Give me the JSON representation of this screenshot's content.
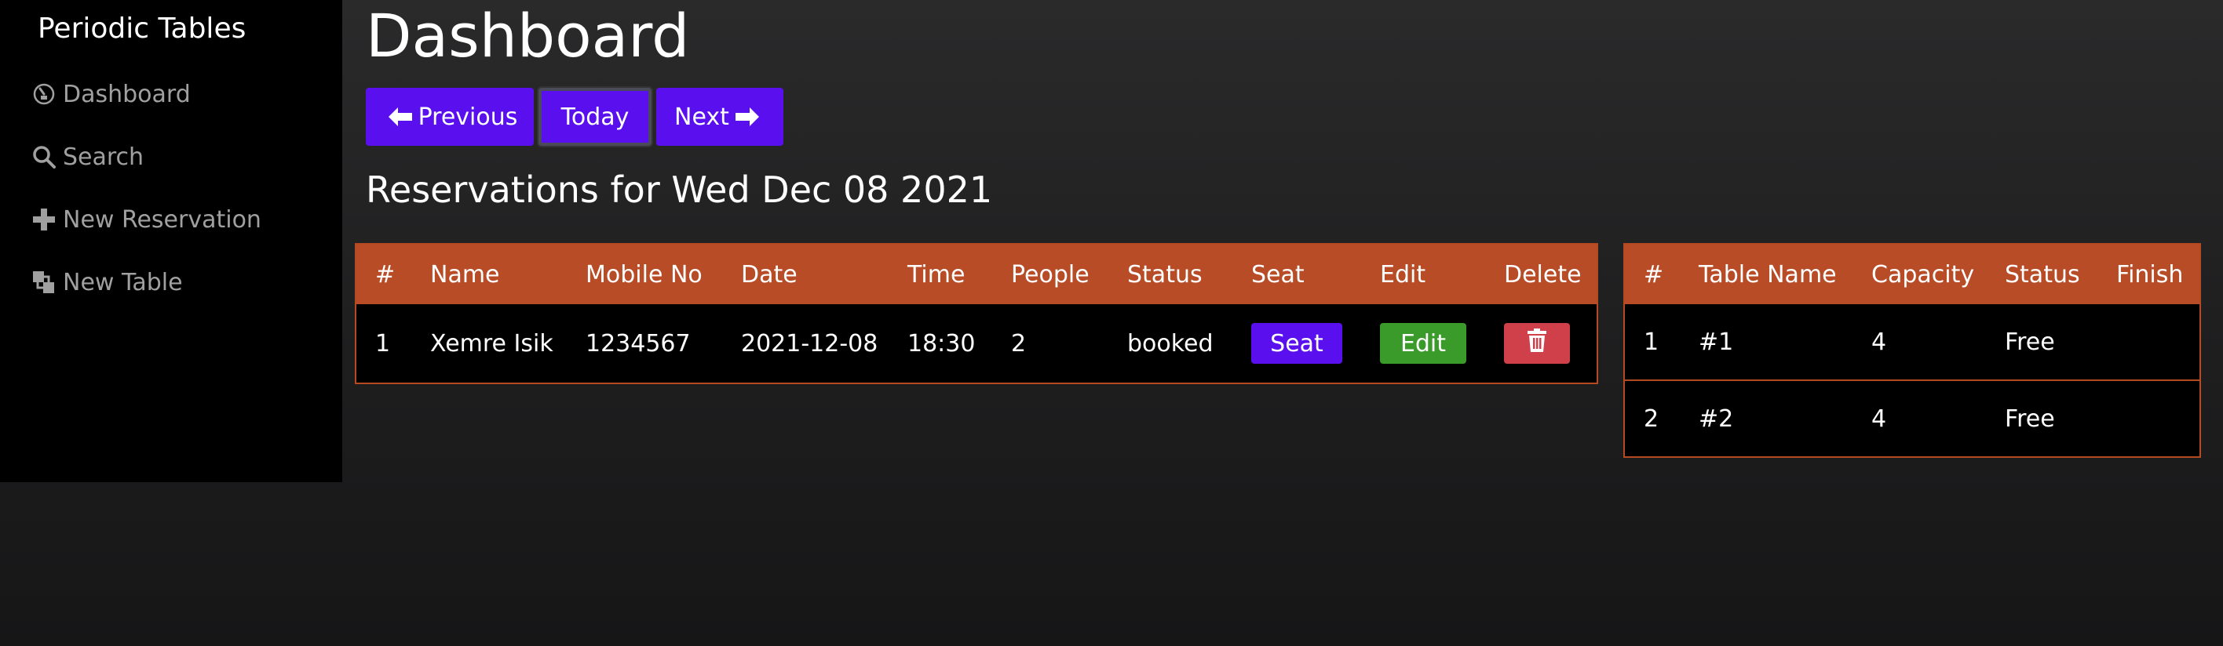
{
  "sidebar": {
    "brand": "Periodic Tables",
    "items": [
      {
        "label": "Dashboard",
        "icon": "dashboard-icon"
      },
      {
        "label": "Search",
        "icon": "search-icon"
      },
      {
        "label": "New Reservation",
        "icon": "plus-icon"
      },
      {
        "label": "New Table",
        "icon": "layers-icon"
      }
    ]
  },
  "main": {
    "title": "Dashboard",
    "nav_buttons": {
      "previous": "Previous",
      "today": "Today",
      "next": "Next"
    },
    "reservations_heading": "Reservations for Wed Dec 08 2021"
  },
  "reservations": {
    "columns": [
      "#",
      "Name",
      "Mobile No",
      "Date",
      "Time",
      "People",
      "Status",
      "Seat",
      "Edit",
      "Delete"
    ],
    "rows": [
      {
        "id": "1",
        "name": "Xemre Isik",
        "mobile": "1234567",
        "date": "2021-12-08",
        "time": "18:30",
        "people": "2",
        "status": "booked",
        "seat_label": "Seat",
        "edit_label": "Edit"
      }
    ]
  },
  "tables": {
    "columns": [
      "#",
      "Table Name",
      "Capacity",
      "Status",
      "Finish"
    ],
    "rows": [
      {
        "id": "1",
        "name": "#1",
        "capacity": "4",
        "status": "Free"
      },
      {
        "id": "2",
        "name": "#2",
        "capacity": "4",
        "status": "Free"
      }
    ]
  },
  "colors": {
    "accent": "#5a10ee",
    "header_row": "#b74c27",
    "edit": "#3a9a2a",
    "delete": "#d0404a",
    "sidebar_bg": "#000000"
  }
}
